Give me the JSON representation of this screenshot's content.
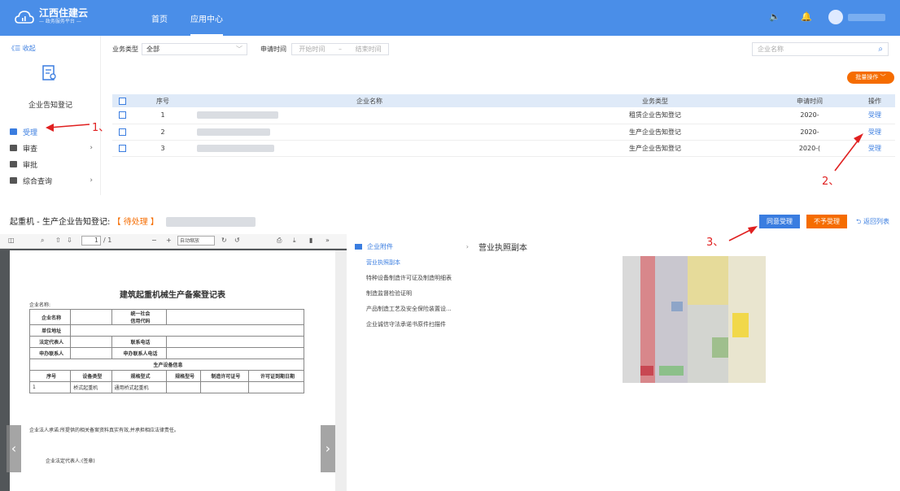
{
  "app": {
    "title": "江西住建云",
    "subtitle": "— 政务服务平台 —"
  },
  "topnav": {
    "home": "首页",
    "app_center": "应用中心"
  },
  "sidebar": {
    "collapse": "《☰ 收起",
    "module_title": "企业告知登记",
    "items": [
      {
        "label": "受理",
        "active": true,
        "chevron": ""
      },
      {
        "label": "审查",
        "active": false,
        "chevron": "›"
      },
      {
        "label": "审批",
        "active": false,
        "chevron": ""
      },
      {
        "label": "综合查询",
        "active": false,
        "chevron": "›"
      }
    ]
  },
  "filter": {
    "type_label": "业务类型",
    "type_value": "全部",
    "date_label": "申请时间",
    "start": "开始时间",
    "sep": "–",
    "end": "结束时间",
    "search_placeholder": "企业名称"
  },
  "batch_button": "批量操作 ﹀",
  "table": {
    "headers": [
      "序号",
      "企业名称",
      "业务类型",
      "申请时间",
      "操作"
    ],
    "rows": [
      {
        "no": "1",
        "type": "租赁企业告知登记",
        "time": "2020-",
        "op": "受理"
      },
      {
        "no": "2",
        "type": "生产企业告知登记",
        "time": "2020-",
        "op": "受理"
      },
      {
        "no": "3",
        "type": "生产企业告知登记",
        "time": "2020-(",
        "op": "受理"
      }
    ]
  },
  "annotations": [
    "1、",
    "2、",
    "3、"
  ],
  "detail": {
    "title": "起重机 - 生产企业告知登记:",
    "status": "【 待处理 】",
    "agree": "同意受理",
    "reject": "不予受理",
    "back": "⮌ 返回列表"
  },
  "pdf": {
    "page": "1",
    "page_total": "/ 1",
    "zoom": "自动缩放",
    "doc_title": "建筑起重机械生产备案登记表",
    "company_label": "企业名称:",
    "rows": {
      "company": "企业名称",
      "credit": "统一社会\n信用代码",
      "address": "单位地址",
      "legal": "法定代表人",
      "phone": "联系电话",
      "contact": "申办联系人",
      "contact_phone": "申办联系人电话",
      "equip": "生产设备信息"
    },
    "equip_headers": [
      "序号",
      "设备类型",
      "规格型式",
      "规格型号",
      "制造许可证号",
      "许可证到期日期"
    ],
    "equip_row": [
      "1",
      "桥式起重机",
      "通用桥式起重机"
    ],
    "promise": "企业法人承诺:所提供的相关备案资料真实有效,并承担相应法律责任。",
    "sign": "企业法定代表人:(签章)"
  },
  "attachments": {
    "heading": "企业附件",
    "items": [
      "营业执照副本",
      "特种设备制造许可证及制造明细表",
      "制造监督检验证明",
      "产品制造工艺及安全保险装置设...",
      "企业诚信守法承诺书原件扫描件"
    ],
    "selected": "营业执照副本"
  }
}
